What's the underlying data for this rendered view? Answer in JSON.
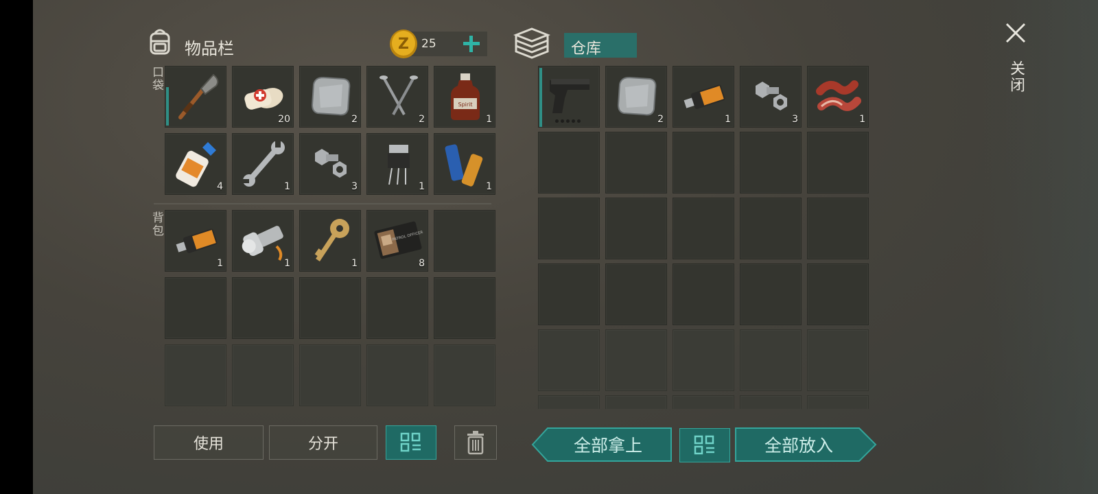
{
  "inventory": {
    "title": "物品栏",
    "pocket_label": "口袋",
    "backpack_label": "背包",
    "coins": "25",
    "pocket_items": [
      {
        "icon": "shovel-icon",
        "count": "",
        "selected": true
      },
      {
        "icon": "bandage-icon",
        "count": "20"
      },
      {
        "icon": "metal-plate-icon",
        "count": "2"
      },
      {
        "icon": "nails-icon",
        "count": "2"
      },
      {
        "icon": "spirit-bottle-icon",
        "count": "1"
      },
      {
        "icon": "glue-icon",
        "count": "4"
      },
      {
        "icon": "wrench-icon",
        "count": "1"
      },
      {
        "icon": "bolt-nut-icon",
        "count": "3"
      },
      {
        "icon": "transistor-icon",
        "count": "1"
      },
      {
        "icon": "batteries-icon",
        "count": "1"
      }
    ],
    "backpack_items": [
      {
        "icon": "usb-drive-icon",
        "count": "1"
      },
      {
        "icon": "flashlight-icon",
        "count": "1"
      },
      {
        "icon": "key-icon",
        "count": "1"
      },
      {
        "icon": "patrol-officer-wallet-icon",
        "count": "8"
      },
      {
        "icon": "",
        "count": ""
      }
    ],
    "wallet_text": "PATROL OFFICER",
    "buttons": {
      "use": "使用",
      "split": "分开"
    }
  },
  "storage": {
    "title": "仓库",
    "items": [
      {
        "icon": "pistol-icon",
        "count": "",
        "selected": true
      },
      {
        "icon": "metal-plate-icon",
        "count": "2"
      },
      {
        "icon": "usb-drive-icon",
        "count": "1"
      },
      {
        "icon": "bolt-nut-icon",
        "count": "3"
      },
      {
        "icon": "bacon-icon",
        "count": "1"
      }
    ],
    "buttons": {
      "take_all": "全部拿上",
      "put_all": "全部放入"
    }
  },
  "close_label": "关闭",
  "colors": {
    "accent": "#2f8f86",
    "teal_dark": "#1f6a64",
    "coin": "#e2a91c",
    "plus": "#2fb3a6"
  }
}
